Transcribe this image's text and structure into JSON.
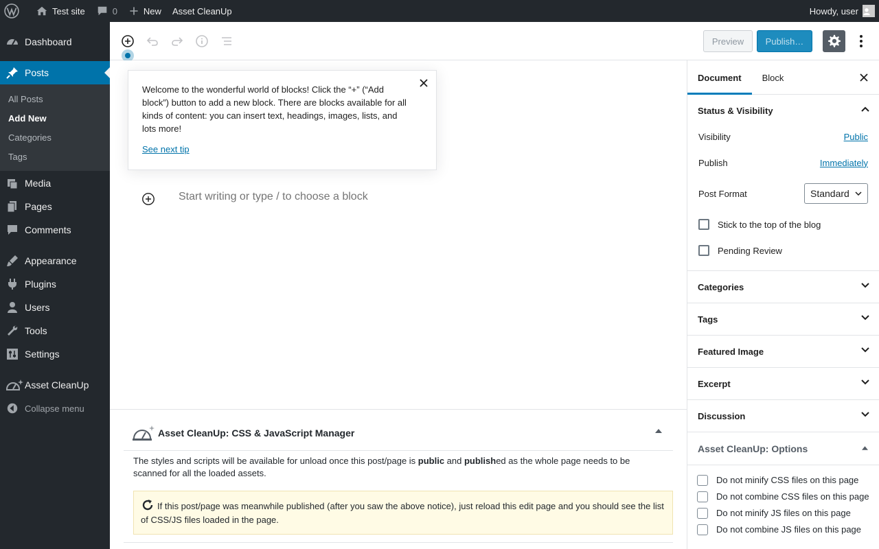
{
  "adminbar": {
    "site_name": "Test site",
    "comments_count": "0",
    "new_label": "New",
    "plugin_label": "Asset CleanUp",
    "greeting": "Howdy, user"
  },
  "menu": {
    "dashboard": "Dashboard",
    "posts": "Posts",
    "posts_sub": [
      "All Posts",
      "Add New",
      "Categories",
      "Tags"
    ],
    "media": "Media",
    "pages": "Pages",
    "comments": "Comments",
    "appearance": "Appearance",
    "plugins": "Plugins",
    "users": "Users",
    "tools": "Tools",
    "settings": "Settings",
    "asset_cleanup": "Asset CleanUp",
    "collapse": "Collapse menu"
  },
  "toolbar": {
    "preview_label": "Preview",
    "publish_label": "Publish…"
  },
  "tip": {
    "text": "Welcome to the wonderful world of blocks! Click the “+” (“Add block”) button to add a new block. There are blocks available for all kinds of content: you can insert text, headings, images, lists, and lots more!",
    "next_link": "See next tip"
  },
  "editor": {
    "placeholder": "Start writing or type / to choose a block"
  },
  "metabox": {
    "title": "Asset CleanUp: CSS & JavaScript Manager",
    "body_pre": "The styles and scripts will be available for unload once this post/page is ",
    "body_public": "public",
    "body_and": " and ",
    "body_publish": "publish",
    "body_post": "ed as the whole page needs to be scanned for all the loaded assets.",
    "notice": "If this post/page was meanwhile published (after you saw the above notice), just reload this edit page and you should see the list of CSS/JS files loaded in the page."
  },
  "sidebar": {
    "tab_document": "Document",
    "tab_block": "Block",
    "status_title": "Status & Visibility",
    "visibility_label": "Visibility",
    "visibility_value": "Public",
    "publish_label": "Publish",
    "publish_value": "Immediately",
    "format_label": "Post Format",
    "format_value": "Standard",
    "stick_label": "Stick to the top of the blog",
    "pending_label": "Pending Review",
    "panels": [
      "Categories",
      "Tags",
      "Featured Image",
      "Excerpt",
      "Discussion"
    ],
    "acu_title": "Asset CleanUp: Options",
    "acu_options": [
      "Do not minify CSS files on this page",
      "Do not combine CSS files on this page",
      "Do not minify JS files on this page",
      "Do not combine JS files on this page"
    ]
  },
  "colors": {
    "admin_dark": "#23282d",
    "admin_blue": "#0073aa",
    "submenu_bg": "#32373c"
  }
}
